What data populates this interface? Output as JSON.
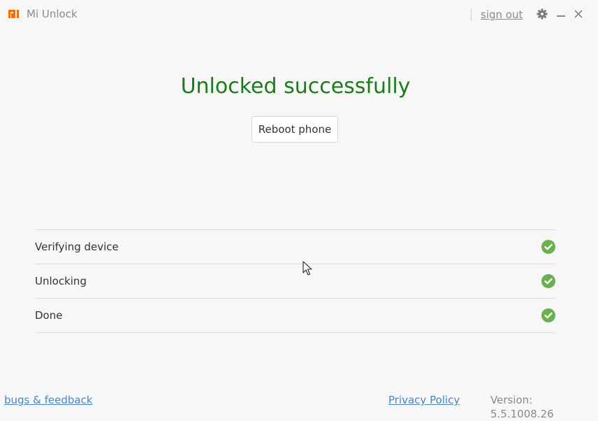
{
  "titlebar": {
    "app_name": "Mi Unlock",
    "sign_out": "sign out",
    "icons": [
      "mi-logo-icon",
      "gear-icon",
      "minimize-icon",
      "close-icon"
    ],
    "logo_color": "#ff6a00"
  },
  "main": {
    "status_title": "Unlocked successfully",
    "status_color": "#1a7d1a",
    "reboot_button": "Reboot phone"
  },
  "steps": [
    {
      "label": "Verifying device",
      "status": "check-circle-icon",
      "color": "#6ab04c"
    },
    {
      "label": "Unlocking",
      "status": "check-circle-icon",
      "color": "#6ab04c"
    },
    {
      "label": "Done",
      "status": "check-circle-icon",
      "color": "#6ab04c"
    }
  ],
  "footer": {
    "bugs_feedback": "bugs & feedback",
    "privacy_policy": "Privacy Policy",
    "version": "Version: 5.5.1008.26",
    "link_color": "#4a86c5"
  }
}
